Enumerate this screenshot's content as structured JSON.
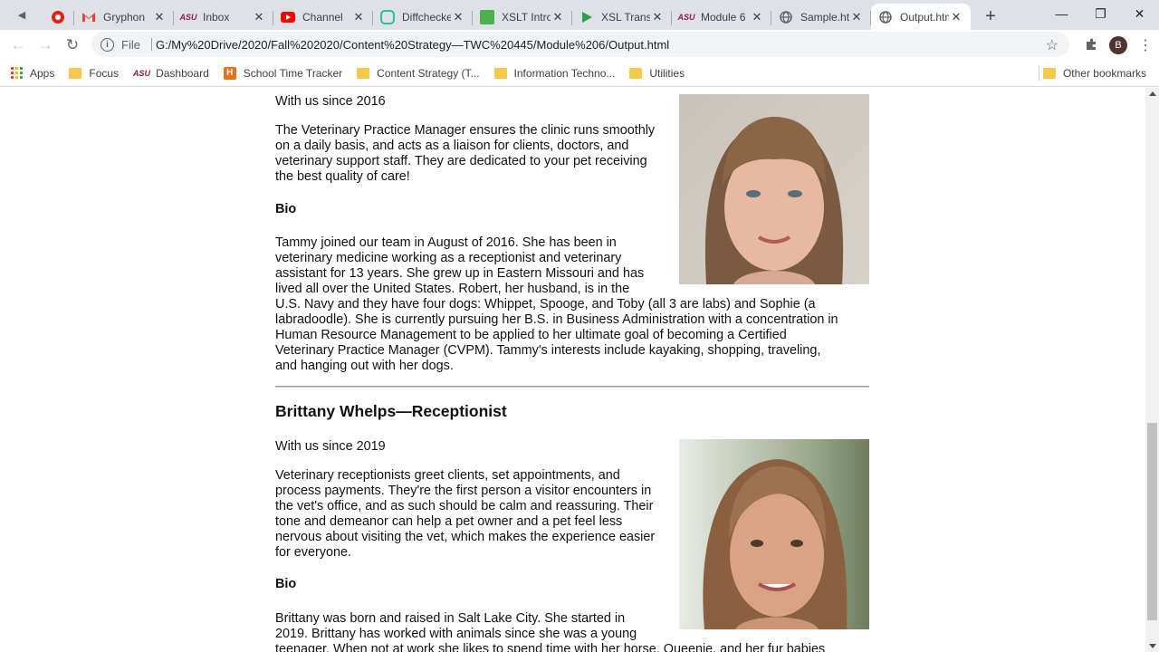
{
  "browser": {
    "tabs": [
      {
        "title": "Gryphon",
        "icon": "gmail-icon"
      },
      {
        "title": "Inbox",
        "icon": "asu-icon"
      },
      {
        "title": "Channel",
        "icon": "youtube-icon"
      },
      {
        "title": "Diffchecker",
        "icon": "diffchecker-icon"
      },
      {
        "title": "XSLT Intro",
        "icon": "w3schools-icon"
      },
      {
        "title": "XSL Trans",
        "icon": "play-icon"
      },
      {
        "title": "Module 6",
        "icon": "asu-icon"
      },
      {
        "title": "Sample.html",
        "icon": "globe-icon"
      },
      {
        "title": "Output.html",
        "icon": "globe-icon"
      }
    ],
    "omnibox": {
      "scheme_label": "File",
      "url": "G:/My%20Drive/2020/Fall%202020/Content%20Strategy—TWC%20445/Module%206/Output.html"
    },
    "profile_initial": "B",
    "bookmarks": [
      {
        "label": "Apps",
        "icon": "apps-grid-icon"
      },
      {
        "label": "Focus",
        "icon": "folder-icon"
      },
      {
        "label": "Dashboard",
        "icon": "asu-icon"
      },
      {
        "label": "School Time Tracker",
        "icon": "harvest-icon"
      },
      {
        "label": "Content Strategy (T...",
        "icon": "folder-icon"
      },
      {
        "label": "Information Techno...",
        "icon": "folder-icon"
      },
      {
        "label": "Utilities",
        "icon": "folder-icon"
      }
    ],
    "other_bookmarks": "Other bookmarks"
  },
  "page": {
    "staff1": {
      "since": "With us since 2016",
      "role_lines": [
        "The Veterinary Practice Manager ensures the clinic runs smoothly",
        "on a daily basis, and acts as a liaison for clients, doctors, and",
        "veterinary support staff. They are dedicated to your pet receiving",
        "the best quality of care!"
      ],
      "bio_heading": "Bio",
      "bio_lines": [
        "Tammy joined our team in August of 2016. She has been in",
        "veterinary medicine working as a receptionist and veterinary",
        "assistant for 13 years. She grew up in Eastern Missouri and has",
        "lived all over the United States. Robert, her husband, is in the",
        "U.S. Navy and they have four dogs: Whippet, Spooge, and Toby (all 3 are labs) and Sophie (a",
        "labradoodle). She is currently pursuing her B.S. in Business Administration with a concentration in",
        "Human Resource Management to be applied to her ultimate goal of becoming a Certified",
        "Veterinary Practice Manager (CVPM). Tammy's interests include kayaking, shopping, traveling,",
        "and hanging out with her dogs."
      ]
    },
    "staff2": {
      "name": "Brittany Whelps—Receptionist",
      "since": "With us since 2019",
      "role_lines": [
        "Veterinary receptionists greet clients, set appointments, and",
        "process payments. They're the first person a visitor encounters in",
        "the vet's office, and as such should be calm and reassuring. Their",
        "tone and demeanor can help a pet owner and a pet feel less",
        "nervous about visiting the vet, which makes the experience easier",
        "for everyone."
      ],
      "bio_heading": "Bio",
      "bio_lines": [
        "Brittany was born and raised in Salt Lake City. She started in",
        "2019. Brittany has worked with animals since she was a young",
        "teenager. When not at work she likes to spend time with her horse, Queenie, and her fur babies"
      ]
    }
  }
}
